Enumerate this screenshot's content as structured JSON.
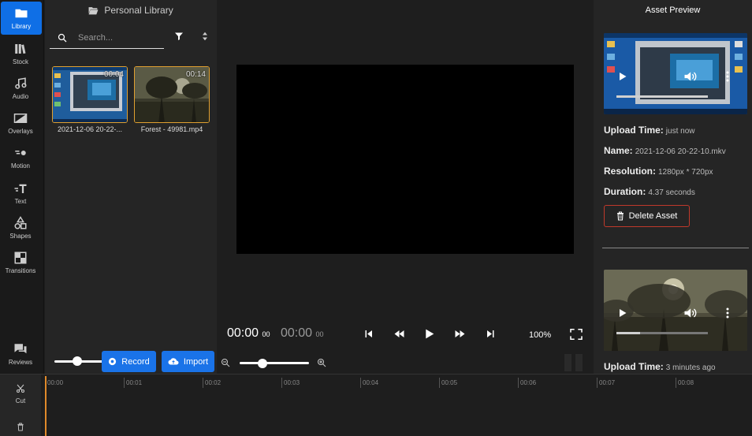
{
  "nav": {
    "items": [
      {
        "label": "Library",
        "icon": "folder-icon"
      },
      {
        "label": "Stock",
        "icon": "books-icon"
      },
      {
        "label": "Audio",
        "icon": "music-icon"
      },
      {
        "label": "Overlays",
        "icon": "overlay-icon"
      },
      {
        "label": "Motion",
        "icon": "motion-icon"
      },
      {
        "label": "Text",
        "icon": "text-icon"
      },
      {
        "label": "Shapes",
        "icon": "shapes-icon"
      },
      {
        "label": "Transitions",
        "icon": "transitions-icon"
      },
      {
        "label": "Reviews",
        "icon": "chat-icon"
      }
    ],
    "active_color": "#0f6fe6"
  },
  "library": {
    "title": "Personal Library",
    "search_placeholder": "Search...",
    "assets": [
      {
        "name": "2021-12-06 20-22-...",
        "duration": "00:04"
      },
      {
        "name": "Forest - 49981.mp4",
        "duration": "00:14"
      }
    ],
    "record_label": "Record",
    "import_label": "Import"
  },
  "player": {
    "current_time": "00:00",
    "current_frames": "00",
    "total_time": "00:00",
    "total_frames": "00",
    "zoom": "100%"
  },
  "preview": {
    "title": "Asset Preview",
    "upload_time_label": "Upload Time:",
    "upload_time_value": "just now",
    "name_label": "Name:",
    "name_value": "2021-12-06 20-22-10.mkv",
    "resolution_label": "Resolution:",
    "resolution_value": "1280px * 720px",
    "duration_label": "Duration:",
    "duration_value": "4.37 seconds",
    "delete_label": "Delete Asset",
    "second_upload_label": "Upload Time:",
    "second_upload_value": "3 minutes ago"
  },
  "timeline": {
    "tools": [
      {
        "label": "Cut",
        "icon": "scissors-icon"
      },
      {
        "label": "",
        "icon": "trash-icon"
      }
    ],
    "ticks": [
      "00:00",
      "00:01",
      "00:02",
      "00:03",
      "00:04",
      "00:05",
      "00:06",
      "00:07",
      "00:08"
    ],
    "playhead_color": "#e08a2a"
  }
}
